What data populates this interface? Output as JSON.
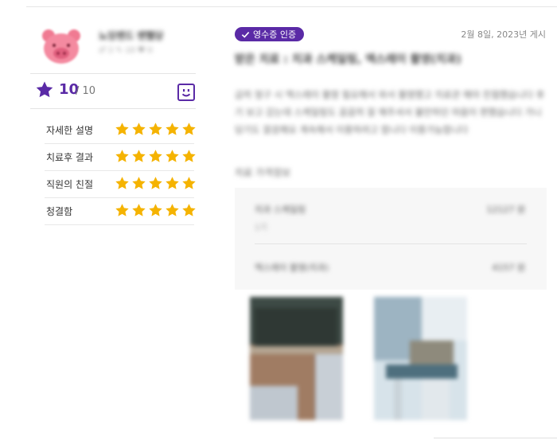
{
  "colors": {
    "accent": "#5a2aa6",
    "star": "#f5b301"
  },
  "reviewer": {
    "nickname": "뇨잉밴드 밴뻘당",
    "stats": "♂ 2   ✎ 10   ♥ 0",
    "avatar_icon": "pig-face-icon"
  },
  "score": {
    "value": "10",
    "max": "/ 10"
  },
  "ratings": [
    {
      "label": "자세한 설명",
      "stars": 5
    },
    {
      "label": "치료후 결과",
      "stars": 5
    },
    {
      "label": "직원의 친절",
      "stars": 5
    },
    {
      "label": "청결함",
      "stars": 5
    }
  ],
  "review": {
    "badge": "영수증 인증",
    "date": "2월 8일, 2023년 게시",
    "title": "받은 치료 : 치과 스케일링, 엑스레이 촬영(치과)",
    "body": "급히 청구 시 엑스레이 촬영 필요해서 와서 촬영했고 치료관 해야 친절했습니다 후기 보고 갔는데 스케일링도 꼼꼼히 잘 해주셔서 불안하던 마음이 편했습니다 가니 당기도 깔끔해요 계속해서 이용하려고 합니다 이용가능합니다"
  },
  "price": {
    "heading": "치료 가격정보",
    "items": [
      {
        "name": "치과 스케일링",
        "value": "12127 원",
        "sub": "1기"
      },
      {
        "name": "엑스레이 촬영(치과)",
        "value": "4157 원",
        "sub": ""
      }
    ]
  }
}
